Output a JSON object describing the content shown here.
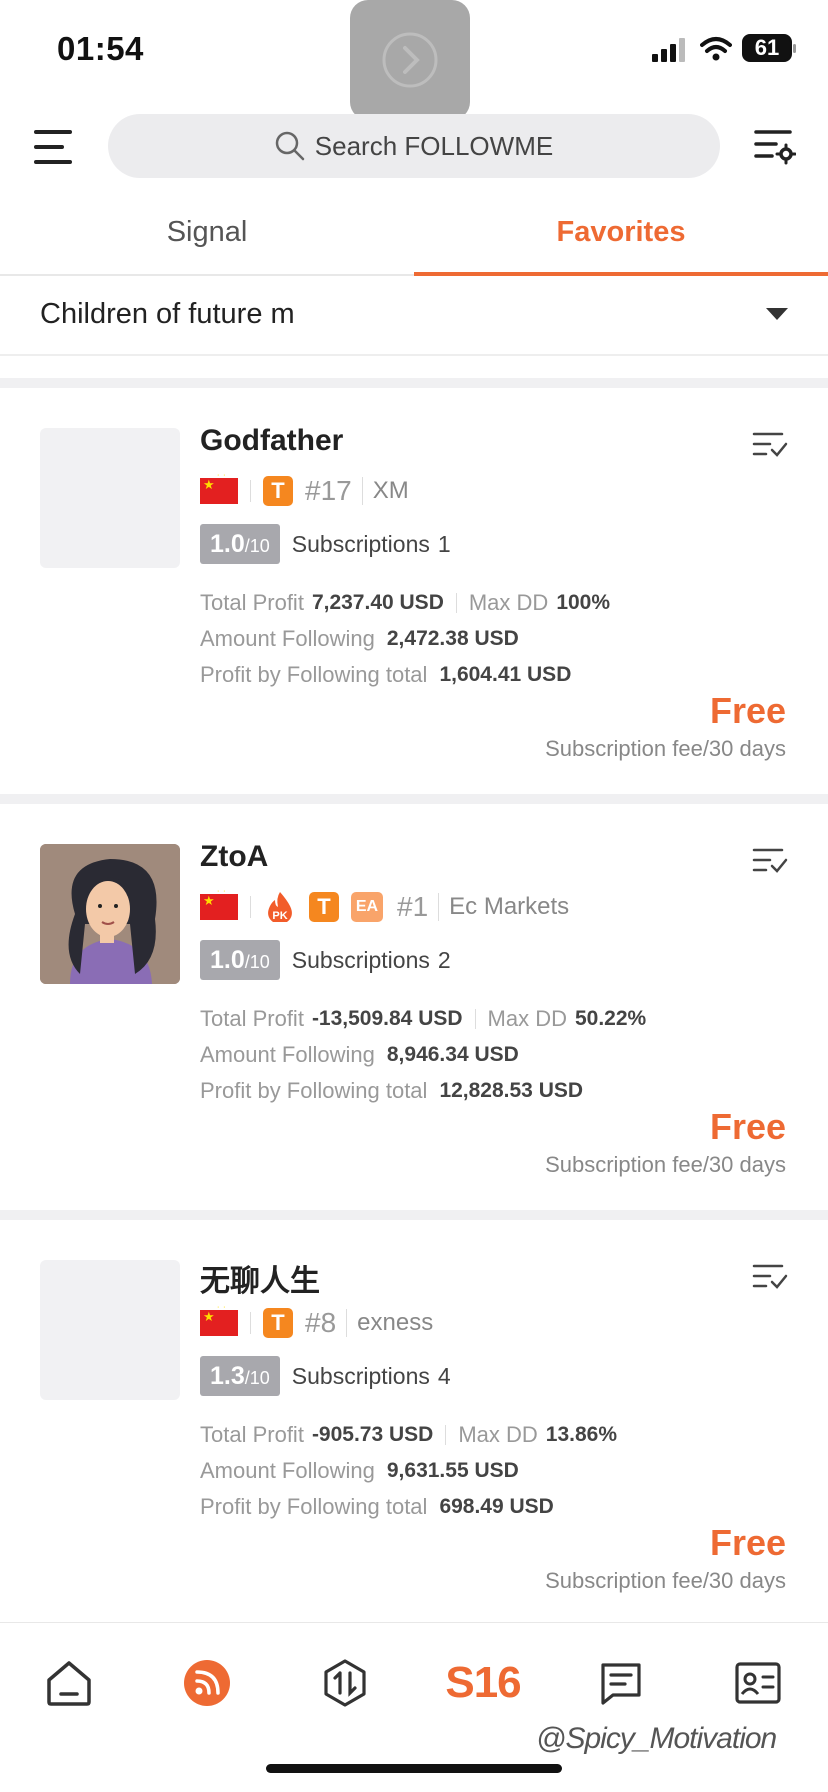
{
  "status_bar": {
    "time": "01:54",
    "battery": "61"
  },
  "header": {
    "search_placeholder": "Search FOLLOWME"
  },
  "tabs": [
    {
      "label": "Signal",
      "active": false
    },
    {
      "label": "Favorites",
      "active": true
    }
  ],
  "group": {
    "name": "Children of future m"
  },
  "cards": [
    {
      "name": "Godfather",
      "rank": "#17",
      "broker": "XM",
      "score": "1.0",
      "score_max": "/10",
      "subscriptions_label": "Subscriptions",
      "subscriptions": "1",
      "total_profit_label": "Total Profit",
      "total_profit": "7,237.40 USD",
      "max_dd_label": "Max DD",
      "max_dd": "100%",
      "amount_following_label": "Amount Following",
      "amount_following": "2,472.38 USD",
      "profit_following_label": "Profit by Following total",
      "profit_following": "1,604.41 USD",
      "fee": "Free",
      "fee_period": "Subscription fee/30 days"
    },
    {
      "name": "ZtoA",
      "rank": "#1",
      "broker": "Ec Markets",
      "badge_pk": "PK",
      "badge_ea": "EA",
      "score": "1.0",
      "score_max": "/10",
      "subscriptions_label": "Subscriptions",
      "subscriptions": "2",
      "total_profit_label": "Total Profit",
      "total_profit": "-13,509.84 USD",
      "max_dd_label": "Max DD",
      "max_dd": "50.22%",
      "amount_following_label": "Amount Following",
      "amount_following": "8,946.34 USD",
      "profit_following_label": "Profit by Following total",
      "profit_following": "12,828.53 USD",
      "fee": "Free",
      "fee_period": "Subscription fee/30 days"
    },
    {
      "name": "无聊人生",
      "rank": "#8",
      "broker": "exness",
      "score": "1.3",
      "score_max": "/10",
      "subscriptions_label": "Subscriptions",
      "subscriptions": "4",
      "total_profit_label": "Total Profit",
      "total_profit": "-905.73 USD",
      "max_dd_label": "Max DD",
      "max_dd": "13.86%",
      "amount_following_label": "Amount Following",
      "amount_following": "9,631.55 USD",
      "profit_following_label": "Profit by Following total",
      "profit_following": "698.49 USD",
      "fee": "Free",
      "fee_period": "Subscription fee/30 days"
    }
  ],
  "badge_t": "T",
  "bottom_nav": {
    "s16_label": "S16"
  },
  "watermark": "@Spicy_Motivation",
  "colors": {
    "accent": "#ee6a33",
    "badge_t": "#f5871f"
  }
}
